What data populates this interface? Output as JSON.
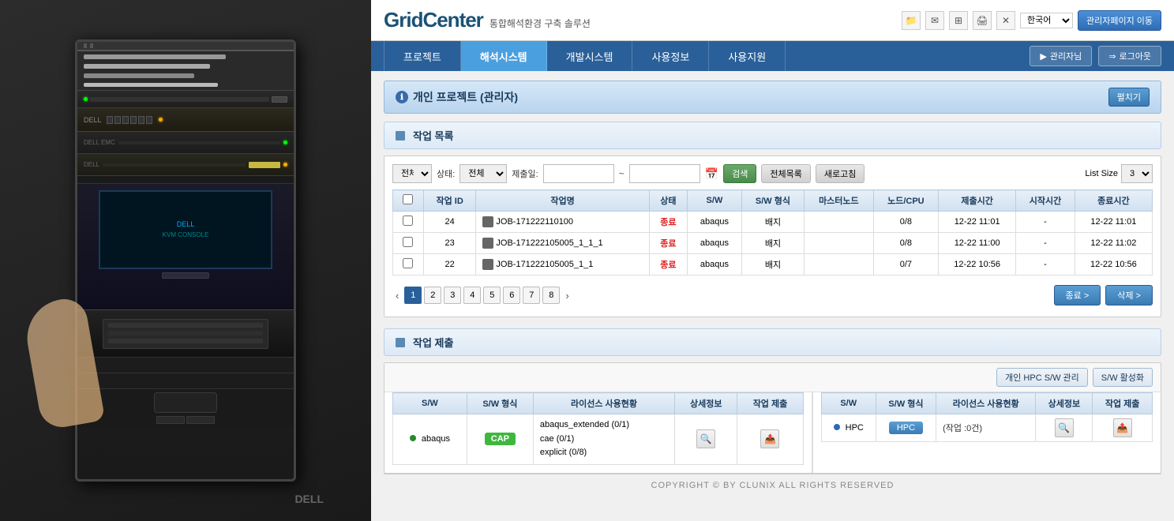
{
  "brand": {
    "name": "GridCenter",
    "subtitle": "통합해석환경 구축 솔루션"
  },
  "header": {
    "admin_move_label": "관리자페이지 이동",
    "lang": "한국어"
  },
  "nav": {
    "items": [
      {
        "label": "프로젝트",
        "active": false
      },
      {
        "label": "해석시스템",
        "active": true
      },
      {
        "label": "개발시스템",
        "active": false
      },
      {
        "label": "사용정보",
        "active": false
      },
      {
        "label": "사용지원",
        "active": false
      }
    ],
    "admin_label": "관리자님",
    "logout_label": "로그아웃"
  },
  "personal_project": {
    "title": "개인 프로젝트 (관리자)",
    "expand_label": "펼치기"
  },
  "job_list": {
    "section_title": "작업 목록",
    "filter": {
      "all_label": "전체",
      "status_label": "상태:",
      "status_options": [
        "전체"
      ],
      "submit_date_label": "제출일:",
      "to_label": "~",
      "search_label": "검색",
      "list_btn": "전체목록",
      "refresh_btn": "새로고침",
      "list_size_label": "List Size",
      "list_size_value": "3"
    },
    "columns": [
      "작업 ID",
      "작업명",
      "상태",
      "S/W",
      "S/W 형식",
      "마스터노드",
      "노드/CPU",
      "제출시간",
      "시작시간",
      "종료시간"
    ],
    "rows": [
      {
        "id": "24",
        "name": "JOB-171222110100",
        "status": "종료",
        "sw": "abaqus",
        "sw_type": "배지",
        "master_node": "",
        "node_cpu": "0/8",
        "submit_time": "12-22 11:01",
        "start_time": "-",
        "end_time": "12-22 11:01"
      },
      {
        "id": "23",
        "name": "JOB-171222105005_1_1_1",
        "status": "종료",
        "sw": "abaqus",
        "sw_type": "배지",
        "master_node": "",
        "node_cpu": "0/8",
        "submit_time": "12-22 11:00",
        "start_time": "-",
        "end_time": "12-22 11:02"
      },
      {
        "id": "22",
        "name": "JOB-171222105005_1_1",
        "status": "종료",
        "sw": "abaqus",
        "sw_type": "배지",
        "master_node": "",
        "node_cpu": "0/7",
        "submit_time": "12-22 10:56",
        "start_time": "-",
        "end_time": "12-22 10:56"
      }
    ],
    "pagination": {
      "current": 1,
      "pages": [
        "1",
        "2",
        "3",
        "4",
        "5",
        "6",
        "7",
        "8"
      ]
    },
    "end_btn": "종료 >",
    "delete_btn": "삭제 >"
  },
  "job_submit": {
    "section_title": "작업 제출",
    "hpc_manage_btn": "개인 HPC S/W 관리",
    "sw_activate_btn": "S/W 활성화",
    "left_columns": [
      "S/W",
      "S/W 형식",
      "라이선스 사용현황",
      "상세정보",
      "작업 제출"
    ],
    "left_rows": [
      {
        "sw": "abaqus",
        "sw_type": "CAP",
        "licenses": "abaqus_extended (0/1)\ncae (0/1)\nexplicit (0/8)"
      }
    ],
    "right_columns": [
      "S/W",
      "S/W 형식",
      "라이선스 사용현황",
      "상세정보",
      "작업 제출"
    ],
    "right_rows": [
      {
        "sw": "HPC",
        "sw_type": "HPC",
        "licenses": "(작업 :0건)"
      }
    ]
  },
  "footer": {
    "text": "COPYRIGHT © BY CLUNIX ALL RIGHTS RESERVED"
  }
}
